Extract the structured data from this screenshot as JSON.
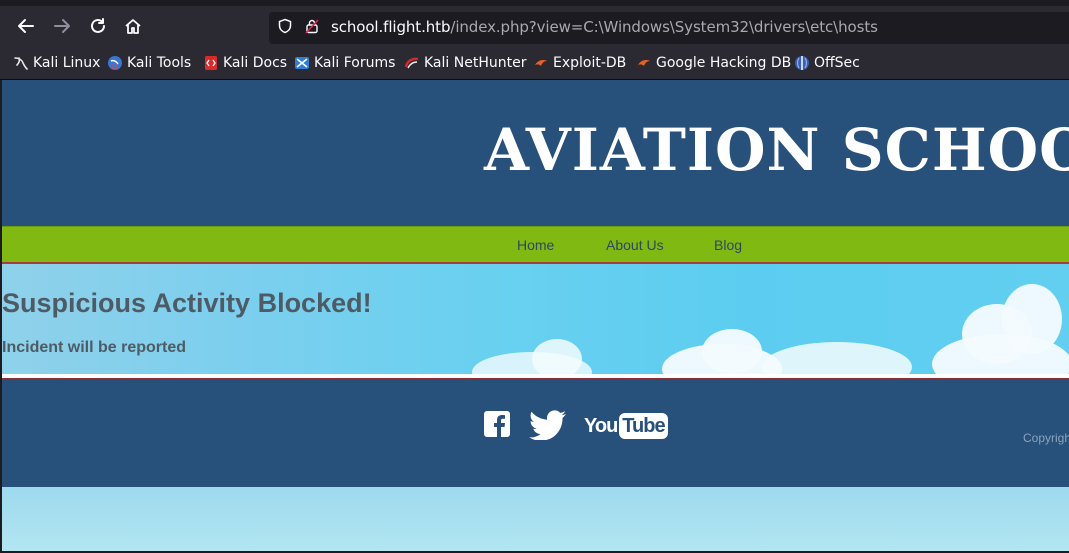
{
  "browser": {
    "url_host": "school.flight.htb",
    "url_path": "/index.php?view=C:\\Windows\\System32\\drivers\\etc\\hosts",
    "bookmarks": [
      {
        "label": "Kali Linux",
        "icon": "kali-dragon-icon"
      },
      {
        "label": "Kali Tools",
        "icon": "kali-tools-icon"
      },
      {
        "label": "Kali Docs",
        "icon": "kali-docs-icon"
      },
      {
        "label": "Kali Forums",
        "icon": "kali-forums-icon"
      },
      {
        "label": "Kali NetHunter",
        "icon": "nethunter-icon"
      },
      {
        "label": "Exploit-DB",
        "icon": "exploit-db-icon"
      },
      {
        "label": "Google Hacking DB",
        "icon": "ghdb-icon"
      },
      {
        "label": "OffSec",
        "icon": "offsec-icon"
      }
    ]
  },
  "site": {
    "title": "AVIATION SCHOOL",
    "nav": [
      "Home",
      "About Us",
      "Blog"
    ],
    "hero_title": "Suspicious Activity Blocked!",
    "hero_subtitle": "Incident will be reported",
    "social": [
      "facebook-icon",
      "twitter-icon",
      "youtube-icon"
    ],
    "youtube_label": "YouTube",
    "copyright": "Copyright"
  },
  "colors": {
    "header_blue": "#27507a",
    "nav_green": "#80b912",
    "text_gray": "#4e5b64"
  }
}
